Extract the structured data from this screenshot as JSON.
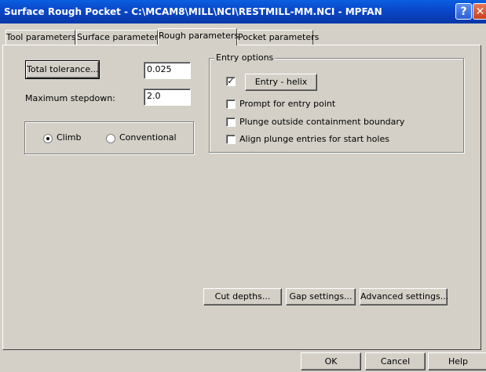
{
  "window": {
    "title": "Surface Rough Pocket - C:\\MCAM8\\MILL\\NCI\\RESTMILL-MM.NCI - MPFAN",
    "help_glyph": "?",
    "close_glyph": "✕"
  },
  "tabs": [
    {
      "label": "Tool parameters",
      "active": false
    },
    {
      "label": "Surface parameters",
      "active": false
    },
    {
      "label": "Rough parameters",
      "active": true
    },
    {
      "label": "Pocket parameters",
      "active": false
    }
  ],
  "rough": {
    "total_tolerance_label": "Total tolerance...",
    "total_tolerance_value": "0.025",
    "max_stepdown_label": "Maximum stepdown:",
    "max_stepdown_value": "2.0",
    "direction": {
      "climb_label": "Climb",
      "conventional_label": "Conventional",
      "selected": "Climb"
    }
  },
  "entry_options": {
    "title": "Entry options",
    "helix_checked": true,
    "helix_button_label": "Entry - helix",
    "check_mark": "✓",
    "prompt_label": "Prompt for entry point",
    "prompt_checked": false,
    "plunge_label": "Plunge outside containment boundary",
    "plunge_checked": false,
    "align_label": "Align plunge entries for start holes",
    "align_checked": false
  },
  "actions": {
    "cut_depths": "Cut depths...",
    "gap_settings": "Gap settings...",
    "advanced_settings": "Advanced settings..."
  },
  "dialog_buttons": {
    "ok": "OK",
    "cancel": "Cancel",
    "help": "Help"
  }
}
